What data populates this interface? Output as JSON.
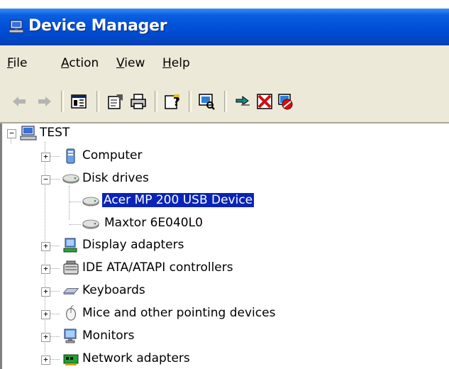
{
  "window": {
    "title": "Device Manager"
  },
  "menu": [
    {
      "label": "File",
      "mnemonic": "F",
      "rest": "ile"
    },
    {
      "label": "Action",
      "mnemonic": "A",
      "rest": "ction"
    },
    {
      "label": "View",
      "mnemonic": "V",
      "rest": "iew"
    },
    {
      "label": "Help",
      "mnemonic": "H",
      "rest": "elp"
    }
  ],
  "toolbar": {
    "buttons": [
      "back-arrow-icon",
      "forward-arrow-icon",
      "show-hide-console-tree-icon",
      "properties-icon",
      "print-icon",
      "help-icon",
      "scan-hardware-icon",
      "update-driver-icon",
      "uninstall-icon",
      "disable-icon"
    ]
  },
  "tree": {
    "root": {
      "label": "TEST",
      "expanded": true,
      "icon": "computer-icon"
    },
    "nodes": [
      {
        "label": "Computer",
        "icon": "computer-category-icon",
        "expanded": false
      },
      {
        "label": "Disk drives",
        "icon": "disk-drive-icon",
        "expanded": true,
        "children": [
          {
            "label": "Acer MP 200 USB Device",
            "icon": "disk-drive-icon",
            "selected": true
          },
          {
            "label": "Maxtor 6E040L0",
            "icon": "disk-drive-icon",
            "selected": false
          }
        ]
      },
      {
        "label": "Display adapters",
        "icon": "display-adapter-icon",
        "expanded": false
      },
      {
        "label": "IDE ATA/ATAPI controllers",
        "icon": "ide-controller-icon",
        "expanded": false
      },
      {
        "label": "Keyboards",
        "icon": "keyboard-icon",
        "expanded": false
      },
      {
        "label": "Mice and other pointing devices",
        "icon": "mouse-icon",
        "expanded": false
      },
      {
        "label": "Monitors",
        "icon": "monitor-icon",
        "expanded": false
      },
      {
        "label": "Network adapters",
        "icon": "network-adapter-icon",
        "expanded": false
      }
    ],
    "selection_color": "#0a24b6"
  },
  "colors": {
    "titlebar": "#0050d8",
    "chrome": "#ece9d8"
  }
}
